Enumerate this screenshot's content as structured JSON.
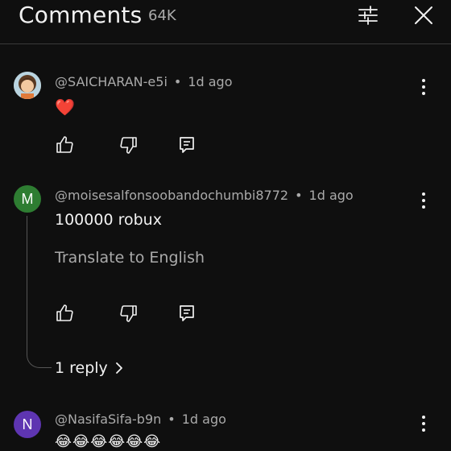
{
  "header": {
    "title": "Comments",
    "count": "64K"
  },
  "comments": [
    {
      "author": "@SAICHARAN-e5i",
      "time": "1d ago",
      "text": "❤️",
      "avatar_initial": ""
    },
    {
      "author": "@moisesalfonsoobandochumbi8772",
      "time": "1d ago",
      "text": "100000 robux",
      "translate": "Translate to English",
      "replies": "1 reply",
      "avatar_initial": "M",
      "avatar_color": "#2e7d32"
    },
    {
      "author": "@NasifaSifa-b9n",
      "time": "1d ago",
      "text": "😂😂😂😂😂😂",
      "avatar_initial": "N",
      "avatar_color": "#5e35b1"
    }
  ],
  "meta_separator": "•",
  "icons": [
    "filter-icon",
    "close-icon",
    "more-vert-icon",
    "like-icon",
    "dislike-icon",
    "reply-icon",
    "chevron-right-icon"
  ]
}
